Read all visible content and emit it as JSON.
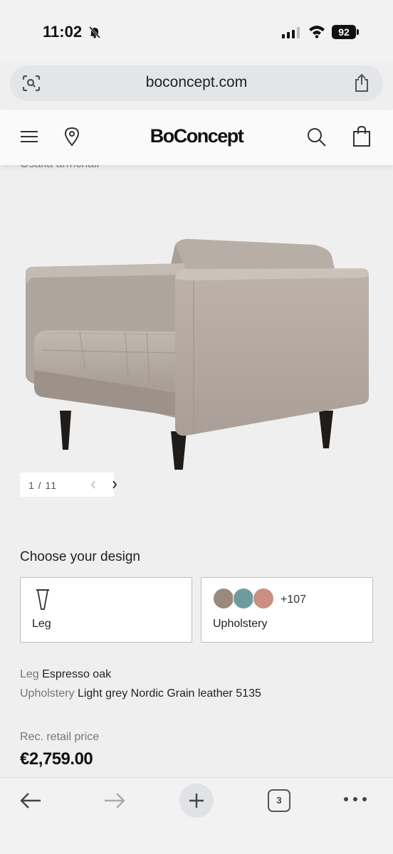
{
  "status_bar": {
    "time": "11:02",
    "battery": "92"
  },
  "browser": {
    "url": "boconcept.com",
    "tab_count": "3"
  },
  "site": {
    "brand": "BoConcept"
  },
  "product": {
    "title": "Osaka armchair",
    "image_alt": "Osaka armchair",
    "pager": {
      "label": "1 / 11",
      "prev": "‹",
      "next": "›"
    }
  },
  "design": {
    "title": "Choose your design",
    "leg_label": "Leg",
    "upholstery_label": "Upholstery",
    "more_swatches": "+107",
    "swatch_colors": [
      "#9b8a7c",
      "#6f9ba0",
      "#c98f80"
    ]
  },
  "specs": [
    {
      "key": "Leg",
      "value": "Espresso oak"
    },
    {
      "key": "Upholstery",
      "value": "Light grey Nordic Grain leather 5135"
    }
  ],
  "price": {
    "label": "Rec. retail price",
    "value": "€2,759.00"
  },
  "colors": {
    "leather": "#b3a89f",
    "legs": "#1e1b19",
    "background": "#efefef"
  }
}
